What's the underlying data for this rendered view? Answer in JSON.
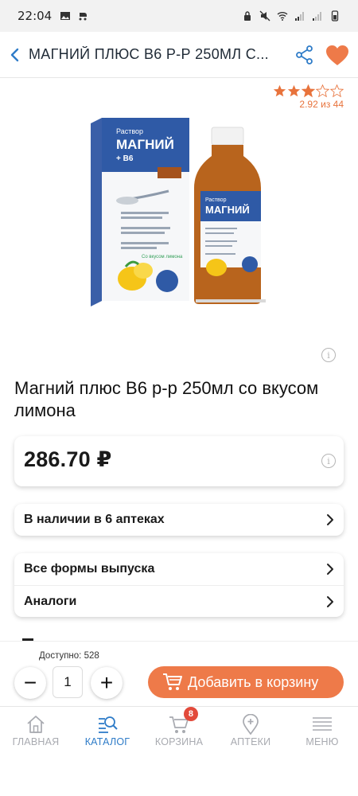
{
  "status_bar": {
    "time": "22:04"
  },
  "header": {
    "title": "МАГНИЙ ПЛЮС В6 Р-Р 250МЛ С...",
    "icons": [
      "back-arrow-icon",
      "share-icon",
      "heart-icon"
    ],
    "accent_color": "#ee7a49"
  },
  "rating": {
    "value": 2.92,
    "max": 5,
    "text": "2.92 из 44"
  },
  "product": {
    "title": "Магний плюс В6 р-р 250мл со вкусом лимона",
    "image_semantic": "product-box-and-bottle",
    "box_text": {
      "type_label": "Раствор",
      "name": "МАГНИЙ",
      "sub": "+ В6",
      "age": "разрешен с 3 х лет",
      "flavor": "Со вкусом лимона"
    }
  },
  "price": {
    "value": "286.70 ₽"
  },
  "rows_a": [
    {
      "label": "В наличии в 6 аптеках"
    }
  ],
  "rows_b": [
    {
      "label": "Все формы выпуска"
    },
    {
      "label": "Аналоги"
    }
  ],
  "buy": {
    "stock_text": "Доступно: 528",
    "quantity": "1",
    "minus": "−",
    "plus": "+",
    "add_label": "Добавить в корзину"
  },
  "nav": {
    "items": [
      {
        "label": "ГЛАВНАЯ",
        "icon": "home-icon"
      },
      {
        "label": "КАТАЛОГ",
        "icon": "catalog-search-icon",
        "active": true
      },
      {
        "label": "КОРЗИНА",
        "icon": "cart-icon",
        "badge": "8"
      },
      {
        "label": "АПТЕКИ",
        "icon": "location-pin-icon"
      },
      {
        "label": "МЕНЮ",
        "icon": "menu-icon"
      }
    ],
    "active_color": "#2f7cc8",
    "badge_color": "#e24a3b"
  }
}
